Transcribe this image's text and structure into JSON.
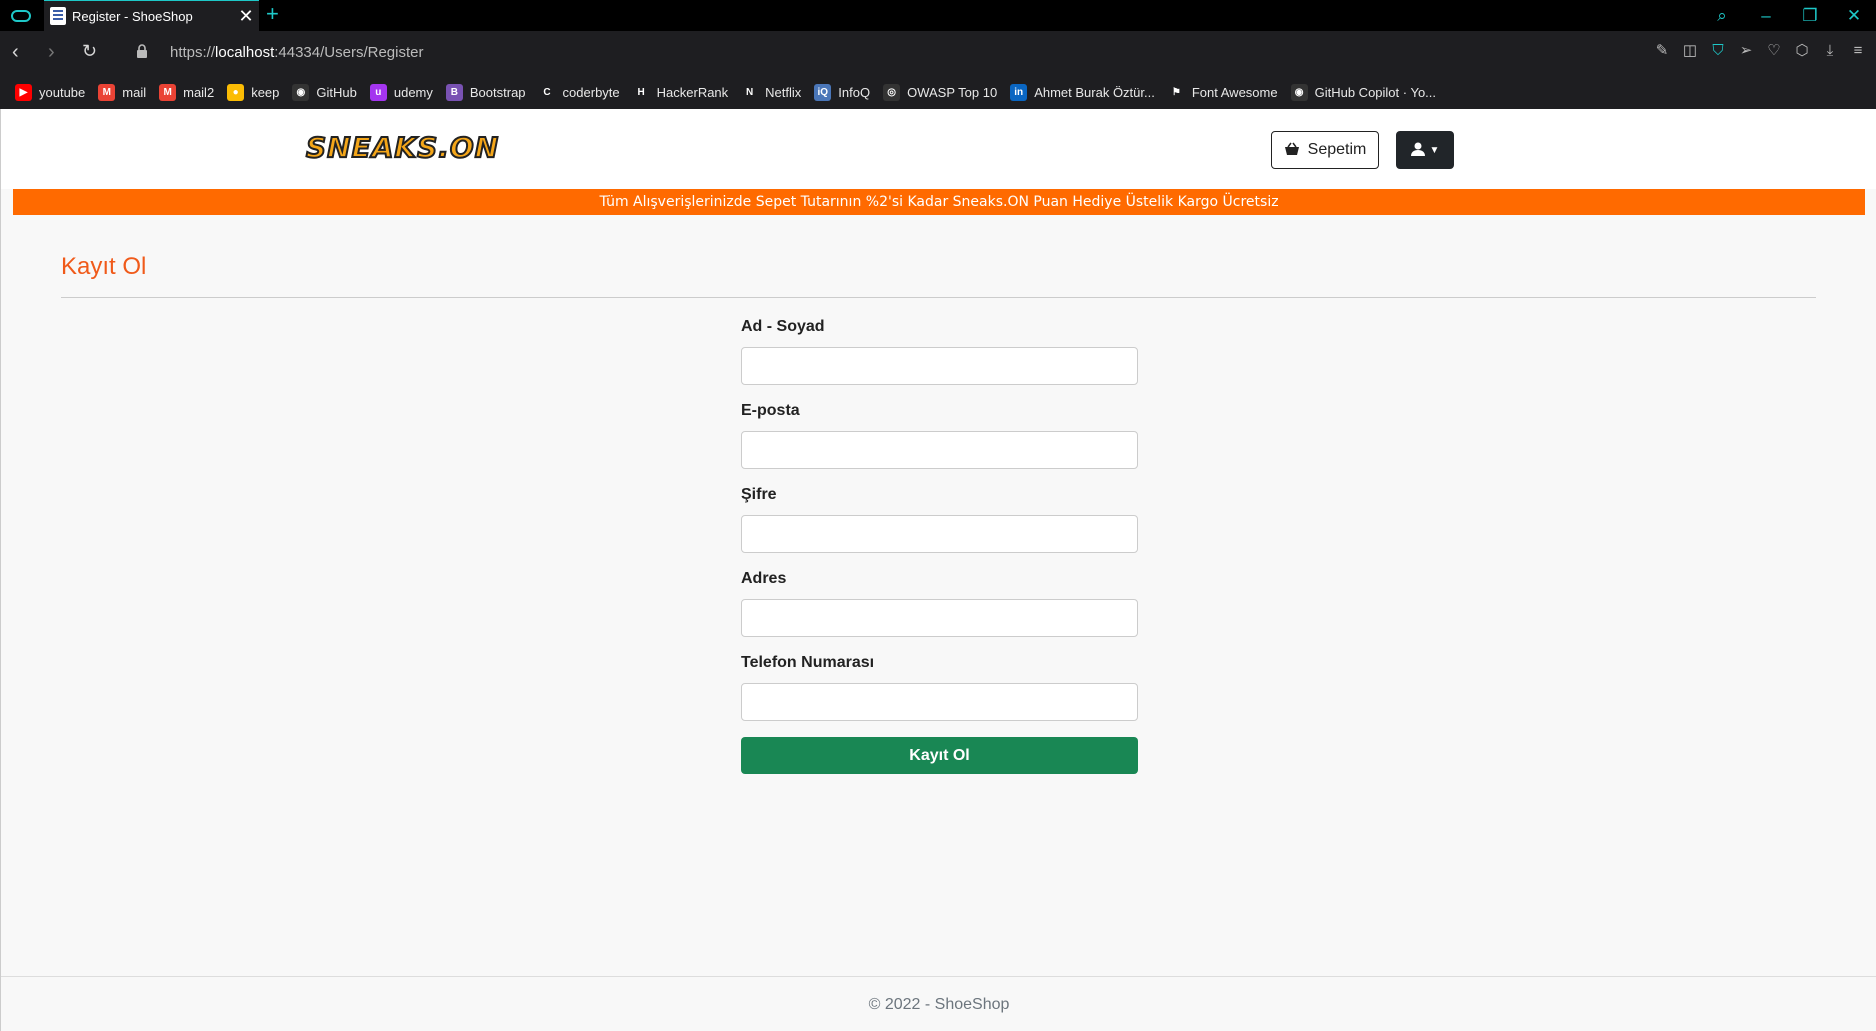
{
  "browser": {
    "tab_title": "Register - ShoeShop",
    "url_prefix": "https://",
    "url_host": "localhost",
    "url_rest": ":44334/Users/Register",
    "bookmarks": [
      {
        "label": "youtube",
        "icon": "youtube-icon",
        "color": "#ff0000",
        "glyph": "▶"
      },
      {
        "label": "mail",
        "icon": "gmail-icon",
        "color": "#ea4335",
        "glyph": "M"
      },
      {
        "label": "mail2",
        "icon": "gmail-icon",
        "color": "#ea4335",
        "glyph": "M"
      },
      {
        "label": "keep",
        "icon": "keep-icon",
        "color": "#fbbc04",
        "glyph": "●"
      },
      {
        "label": "GitHub",
        "icon": "github-icon",
        "color": "#333333",
        "glyph": "◉"
      },
      {
        "label": "udemy",
        "icon": "udemy-icon",
        "color": "#a435f0",
        "glyph": "u"
      },
      {
        "label": "Bootstrap",
        "icon": "bootstrap-icon",
        "color": "#7952b3",
        "glyph": "B"
      },
      {
        "label": "coderbyte",
        "icon": "coderbyte-icon",
        "color": "#1e1e21",
        "glyph": "C"
      },
      {
        "label": "HackerRank",
        "icon": "hackerrank-icon",
        "color": "#1e1e21",
        "glyph": "H"
      },
      {
        "label": "Netflix",
        "icon": "netflix-icon",
        "color": "#1e1e21",
        "glyph": "N"
      },
      {
        "label": "InfoQ",
        "icon": "infoq-icon",
        "color": "#4a76b8",
        "glyph": "iQ"
      },
      {
        "label": "OWASP Top 10",
        "icon": "owasp-icon",
        "color": "#333333",
        "glyph": "◎"
      },
      {
        "label": "Ahmet Burak Öztür...",
        "icon": "linkedin-icon",
        "color": "#0a66c2",
        "glyph": "in"
      },
      {
        "label": "Font Awesome",
        "icon": "flag-icon",
        "color": "#1e1e21",
        "glyph": "⚑"
      },
      {
        "label": "GitHub Copilot · Yo...",
        "icon": "copilot-icon",
        "color": "#333333",
        "glyph": "◉"
      }
    ]
  },
  "header": {
    "logo_text": "SNEAKS.ON",
    "cart_label": "Sepetim"
  },
  "promo": "Tüm Alışverişlerinizde Sepet Tutarının %2'si Kadar Sneaks.ON Puan Hediye Üstelik Kargo Ücretsiz",
  "page_title": "Kayıt Ol",
  "form": {
    "fields": [
      {
        "label": "Ad - Soyad",
        "value": ""
      },
      {
        "label": "E-posta",
        "value": ""
      },
      {
        "label": "Şifre",
        "value": ""
      },
      {
        "label": "Adres",
        "value": ""
      },
      {
        "label": "Telefon Numarası",
        "value": ""
      }
    ],
    "submit_label": "Kayıt Ol"
  },
  "footer": "© 2022 - ShoeShop"
}
